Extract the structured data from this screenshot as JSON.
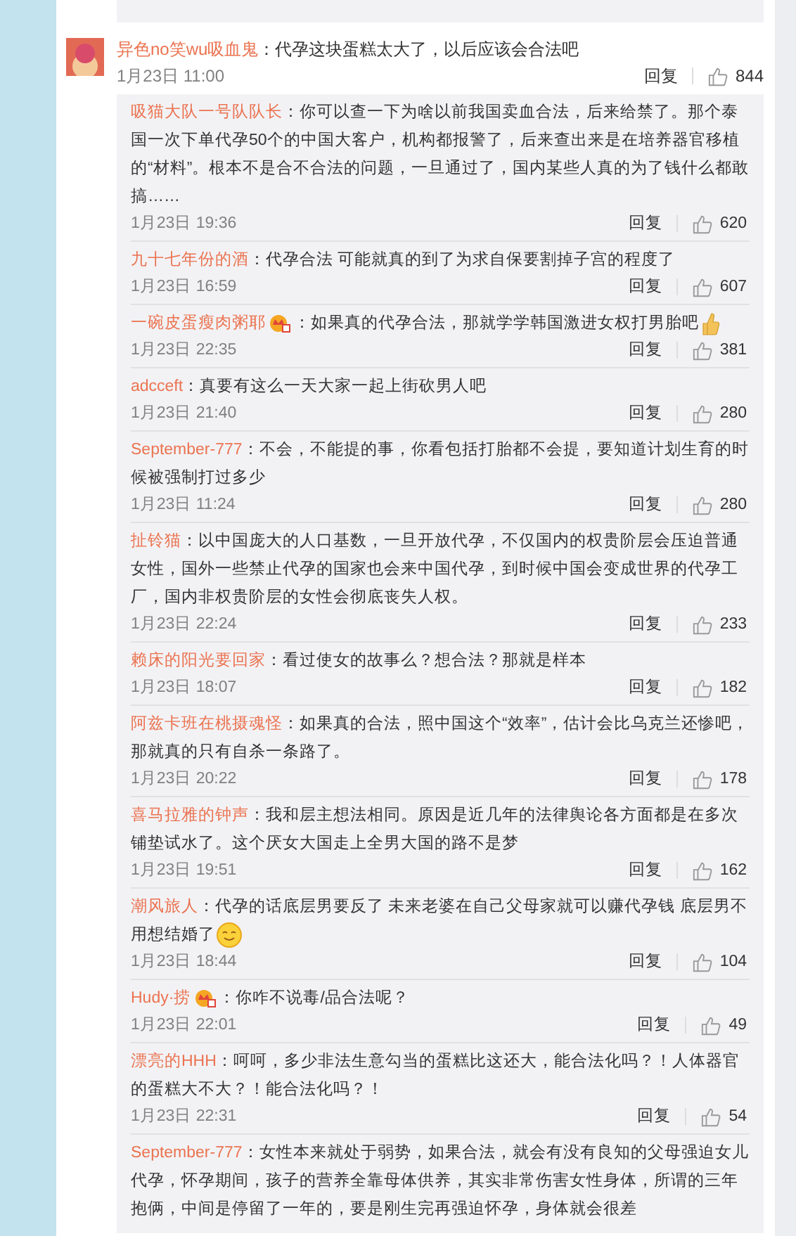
{
  "top_comment": {
    "user": "异色no笑wu吸血鬼",
    "text": "：代孕这块蛋糕太大了，以后应该会合法吧",
    "time": "1月23日 11:00",
    "reply_label": "回复",
    "likes": "844"
  },
  "replies": [
    {
      "user": "吸猫大队一号队队长",
      "vip": false,
      "text": "：你可以查一下为啥以前我国卖血合法，后来给禁了。那个泰国一次下单代孕50个的中国大客户，机构都报警了，后来查出来是在培养器官移植的“材料”。根本不是合不合法的问题，一旦通过了，国内某些人真的为了钱什么都敢搞……",
      "time": "1月23日 19:36",
      "reply_label": "回复",
      "likes": "620"
    },
    {
      "user": "九十七年份的酒",
      "vip": false,
      "text": "：代孕合法 可能就真的到了为求自保要割掉子宫的程度了",
      "time": "1月23日 16:59",
      "reply_label": "回复",
      "likes": "607"
    },
    {
      "user": "一碗皮蛋瘦肉粥耶",
      "vip": true,
      "text": "：如果真的代孕合法，那就学学韩国激进女权打男胎吧",
      "emoji": {
        "kind": "thumbs-up"
      },
      "time": "1月23日 22:35",
      "reply_label": "回复",
      "likes": "381"
    },
    {
      "user": "adcceft",
      "vip": false,
      "text": "：真要有这么一天大家一起上街砍男人吧",
      "time": "1月23日 21:40",
      "reply_label": "回复",
      "likes": "280"
    },
    {
      "user": "September-777",
      "vip": false,
      "text": "：不会，不能提的事，你看包括打胎都不会提，要知道计划生育的时候被强制打过多少",
      "time": "1月23日 11:24",
      "reply_label": "回复",
      "likes": "280"
    },
    {
      "user": "扯铃猫",
      "vip": false,
      "text": "：以中国庞大的人口基数，一旦开放代孕，不仅国内的权贵阶层会压迫普通女性，国外一些禁止代孕的国家也会来中国代孕，到时候中国会变成世界的代孕工厂，国内非权贵阶层的女性会彻底丧失人权。",
      "time": "1月23日 22:24",
      "reply_label": "回复",
      "likes": "233"
    },
    {
      "user": "赖床的阳光要回家",
      "vip": false,
      "text": "：看过使女的故事么？想合法？那就是样本",
      "time": "1月23日 18:07",
      "reply_label": "回复",
      "likes": "182"
    },
    {
      "user": "阿兹卡班在桃摄魂怪",
      "vip": false,
      "text": "：如果真的合法，照中国这个“效率”，估计会比乌克兰还惨吧，那就真的只有自杀一条路了。",
      "time": "1月23日 20:22",
      "reply_label": "回复",
      "likes": "178"
    },
    {
      "user": "喜马拉雅的钟声",
      "vip": false,
      "text": "：我和层主想法相同。原因是近几年的法律舆论各方面都是在多次铺垫试水了。这个厌女大国走上全男大国的路不是梦",
      "time": "1月23日 19:51",
      "reply_label": "回复",
      "likes": "162"
    },
    {
      "user": "潮风旅人",
      "vip": false,
      "text": "：代孕的话底层男要反了 未来老婆在自己父母家就可以赚代孕钱 底层男不用想结婚了",
      "emoji": {
        "kind": "smile"
      },
      "time": "1月23日 18:44",
      "reply_label": "回复",
      "likes": "104"
    },
    {
      "user": "Hudy·捞",
      "vip": true,
      "text": "：你咋不说毒/品合法呢？",
      "time": "1月23日 22:01",
      "reply_label": "回复",
      "likes": "49"
    },
    {
      "user": "漂亮的HHH",
      "vip": false,
      "text": "：呵呵，多少非法生意勾当的蛋糕比这还大，能合法化吗？！人体器官的蛋糕大不大？！能合法化吗？！",
      "time": "1月23日 22:31",
      "reply_label": "回复",
      "likes": "54"
    },
    {
      "user": "September-777",
      "vip": false,
      "text": "：女性本来就处于弱势，如果合法，就会有没有良知的父母强迫女儿代孕，怀孕期间，孩子的营养全靠母体供养，其实非常伤害女性身体，所谓的三年抱俩，中间是停留了一年的，要是刚生完再强迫怀孕，身体就会很差"
    }
  ]
}
